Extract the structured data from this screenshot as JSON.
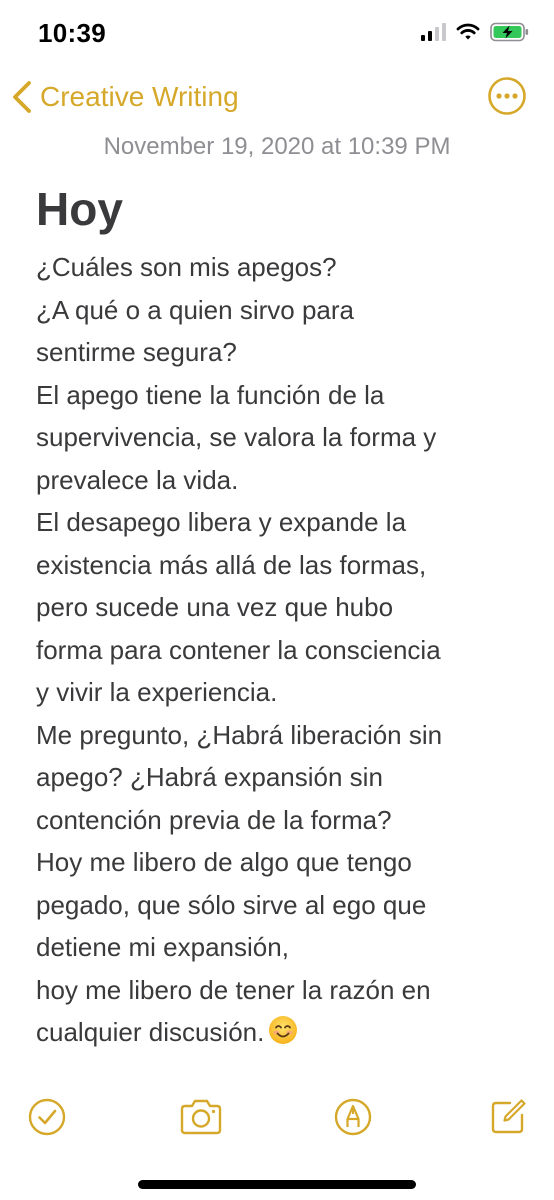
{
  "status_bar": {
    "time": "10:39",
    "icons": [
      "signal-icon",
      "wifi-icon",
      "battery-charging-icon"
    ],
    "battery_color": "#34c759"
  },
  "nav": {
    "back_label": "Creative Writing",
    "back_icon": "chevron-left-icon",
    "more_icon": "ellipsis-circle-icon",
    "accent_color": "#d6a82a"
  },
  "note": {
    "date": "November 19, 2020 at 10:39 PM",
    "title": "Hoy",
    "lines": [
      "¿Cuáles son mis apegos?",
      "¿A qué o a quien sirvo para",
      "sentirme segura?",
      "El apego tiene la función de la",
      "supervivencia, se valora la forma y",
      "prevalece la vida.",
      "El desapego libera y expande la",
      "existencia más allá de las formas,",
      "pero sucede una vez que hubo",
      "forma para contener la consciencia",
      "y vivir la experiencia.",
      "Me pregunto, ¿Habrá liberación sin",
      "apego? ¿Habrá expansión sin",
      "contención previa de la forma?",
      "Hoy me libero de algo que tengo",
      "pegado, que sólo sirve al ego que",
      "detiene mi expansión,",
      "hoy me libero de tener la razón en",
      "cualquier discusión."
    ],
    "trailing_emoji": "smiling-face-icon"
  },
  "toolbar": {
    "items": [
      "checklist-icon",
      "camera-icon",
      "markup-icon",
      "compose-icon"
    ]
  }
}
